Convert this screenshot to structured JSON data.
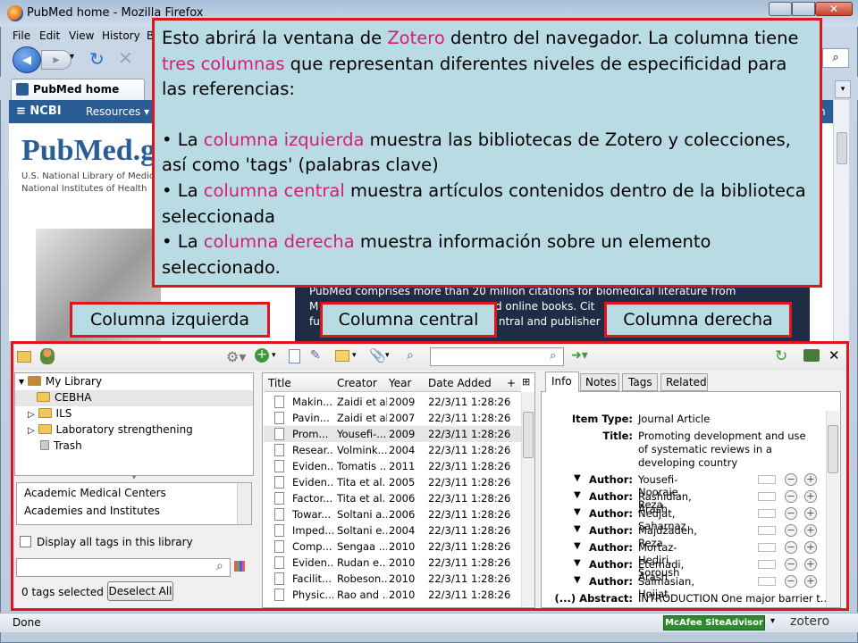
{
  "window": {
    "title": "PubMed home - Mozilla Firefox"
  },
  "menu": [
    "File",
    "Edit",
    "View",
    "History",
    "B"
  ],
  "browser": {
    "tab_label": "PubMed home",
    "ncbi_label": "NCBI",
    "resources": "Resources",
    "status": "Done",
    "mcafee": "McAfee SiteAdvisor",
    "zotero": "zotero"
  },
  "pubmed": {
    "logo": "PubMed.gov",
    "line1": "U.S. National Library of Medicine",
    "line2": "National Institutes of Health",
    "desc1": "PubMed comprises more than 20 million citations for biomedical literature from",
    "desc2": "M",
    "desc2b": "nd online books. Cit",
    "desc3": "fu",
    "desc3b": "ntral and publisher w"
  },
  "callout": {
    "p1a": "Esto abrirá la ventana de ",
    "p1b": "Zotero",
    "p1c": " dentro del navegador. La columna tiene ",
    "p1d": "tres columnas",
    "p1e": " que representan diferentes niveles de especificidad para las referencias:",
    "b1a": "• La ",
    "b1b": "columna izquierda",
    "b1c": " muestra las bibliotecas de Zotero y colecciones, así como 'tags' (palabras clave)",
    "b2a": "• La ",
    "b2b": "columna central",
    "b2c": " muestra artículos contenidos dentro de la biblioteca seleccionada",
    "b3a": "• La ",
    "b3b": "columna derecha",
    "b3c": " muestra información sobre un elemento seleccionado."
  },
  "labels": {
    "left": "Columna izquierda",
    "center": "Columna central",
    "right": "Columna derecha"
  },
  "library": {
    "root": "My Library",
    "items": [
      "CEBHA",
      "ILS",
      "Laboratory strengthening",
      "Trash"
    ]
  },
  "tags": {
    "list": [
      "Academic Medical Centers",
      "Academies and Institutes"
    ],
    "display_all": "Display all tags in this library",
    "selected": "0 tags selected",
    "deselect": "Deselect All"
  },
  "columns": [
    "Title",
    "Creator",
    "Year",
    "Date Added"
  ],
  "rows": [
    [
      "Makin...",
      "Zaidi et al.",
      "2009",
      "22/3/11 1:28:26"
    ],
    [
      "Pavin...",
      "Zaidi et al.",
      "2007",
      "22/3/11 1:28:26"
    ],
    [
      "Prom...",
      "Yousefi-...",
      "2009",
      "22/3/11 1:28:26"
    ],
    [
      "Resear...",
      "Volmink...",
      "2004",
      "22/3/11 1:28:26"
    ],
    [
      "Eviden...",
      "Tomatis ...",
      "2011",
      "22/3/11 1:28:26"
    ],
    [
      "Eviden...",
      "Tita et al.",
      "2005",
      "22/3/11 1:28:26"
    ],
    [
      "Factor...",
      "Tita et al.",
      "2006",
      "22/3/11 1:28:26"
    ],
    [
      "Towar...",
      "Soltani a...",
      "2006",
      "22/3/11 1:28:26"
    ],
    [
      "Imped...",
      "Soltani e...",
      "2004",
      "22/3/11 1:28:26"
    ],
    [
      "Comp...",
      "Sengaa ...",
      "2010",
      "22/3/11 1:28:26"
    ],
    [
      "Eviden...",
      "Rudan e...",
      "2010",
      "22/3/11 1:28:26"
    ],
    [
      "Facilit...",
      "Robeson...",
      "2010",
      "22/3/11 1:28:26"
    ],
    [
      "Physic...",
      "Rao and ...",
      "2010",
      "22/3/11 1:28:26"
    ]
  ],
  "info_tabs": [
    "Info",
    "Notes",
    "Tags",
    "Related"
  ],
  "info": {
    "item_type_label": "Item Type:",
    "item_type": "Journal Article",
    "title_label": "Title:",
    "title": "Promoting development and use of systematic reviews in a developing country",
    "author_label": "Author:",
    "authors": [
      "Yousefi-Nooraie, Reza",
      "Rashidian, Arash",
      "Nedjat, Saharnaz",
      "Majdzadeh, Reza",
      "Mortaz-Hedjri, Soroush",
      "Etemadi, Arash",
      "Salmasian, Hojjat"
    ],
    "abstract_label": "(...) Abstract:",
    "abstract": "INTRODUCTION One major barrier t..."
  }
}
